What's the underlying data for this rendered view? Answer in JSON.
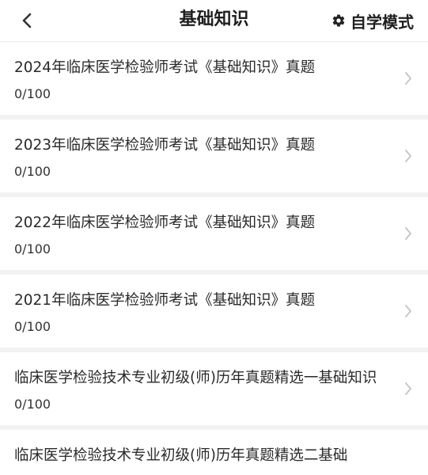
{
  "header": {
    "title": "基础知识",
    "mode_label": "自学模式",
    "back_icon": "chevron-left-icon",
    "mode_icon": "gear-icon"
  },
  "items": [
    {
      "title": "2024年临床医学检验师考试《基础知识》真题",
      "progress": "0/100"
    },
    {
      "title": "2023年临床医学检验师考试《基础知识》真题",
      "progress": "0/100"
    },
    {
      "title": "2022年临床医学检验师考试《基础知识》真题",
      "progress": "0/100"
    },
    {
      "title": "2021年临床医学检验师考试《基础知识》真题",
      "progress": "0/100"
    },
    {
      "title": "临床医学检验技术专业初级(师)历年真题精选一基础知识",
      "progress": "0/100"
    },
    {
      "title": "临床医学检验技术专业初级(师)历年真题精选二基础",
      "progress": ""
    }
  ],
  "colors": {
    "background": "#f2f2f2",
    "card": "#ffffff",
    "chevron": "#c4c4c4"
  }
}
